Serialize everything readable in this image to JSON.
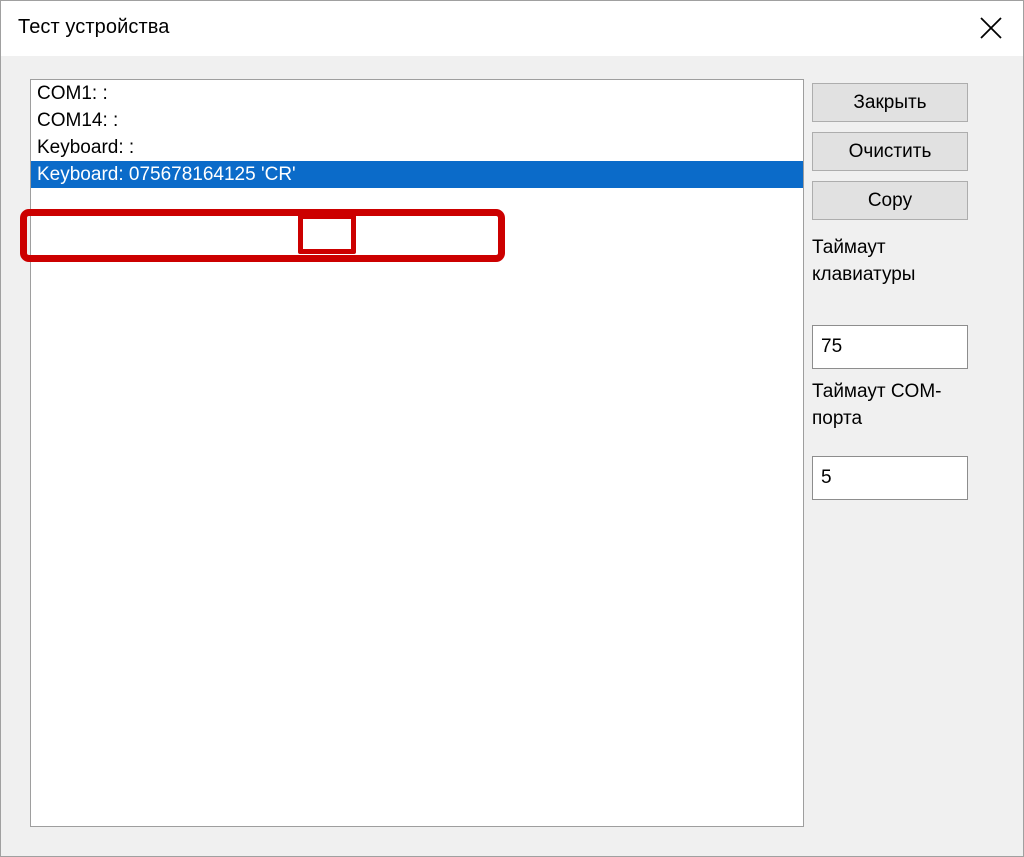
{
  "window": {
    "title": "Тест устройства",
    "close_icon": "close-icon"
  },
  "log": {
    "lines": [
      {
        "text": "COM1: :",
        "selected": false
      },
      {
        "text": "COM14: :",
        "selected": false
      },
      {
        "text": "Keyboard: :",
        "selected": false
      },
      {
        "text": "Keyboard: 075678164125 'CR'",
        "selected": true
      }
    ]
  },
  "buttons": {
    "close": "Закрыть",
    "clear": "Очистить",
    "copy": "Copy"
  },
  "fields": {
    "keyboard_timeout_label": "Таймаут клавиатуры",
    "keyboard_timeout_value": "75",
    "com_timeout_label": "Таймаут COM-порта",
    "com_timeout_value": "5"
  },
  "annotations": {
    "highlight_color": "#cc0000",
    "outer_target": "Keyboard: 075678164125 'CR'",
    "inner_target": "'CR'"
  },
  "colors": {
    "selection": "#0b6bc9",
    "button_face": "#e1e1e1",
    "dialog_face": "#f0f0f0"
  }
}
